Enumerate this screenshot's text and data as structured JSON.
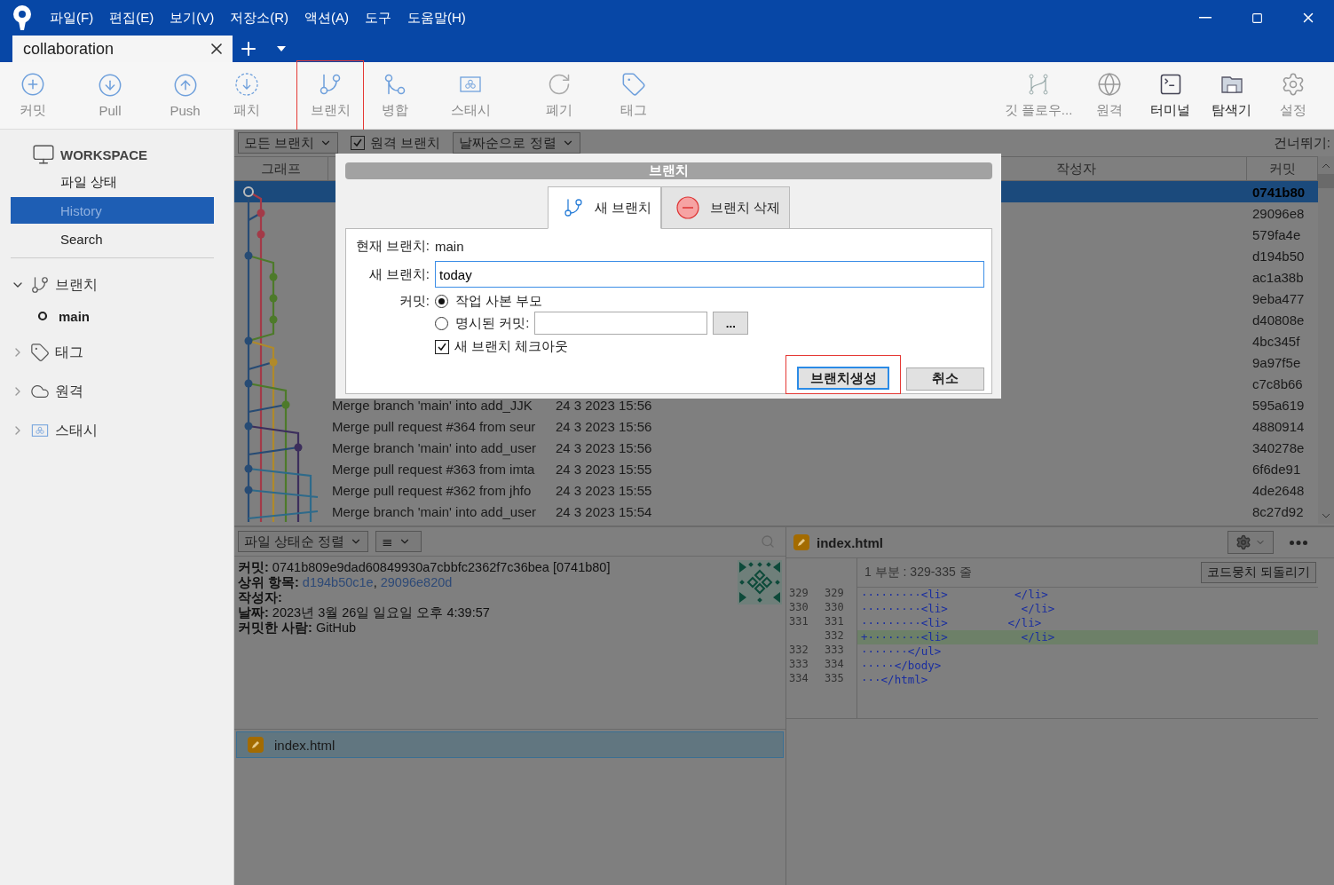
{
  "window": {
    "menu": [
      "파일(F)",
      "편집(E)",
      "보기(V)",
      "저장소(R)",
      "액션(A)",
      "도구",
      "도움말(H)"
    ]
  },
  "tabs": [
    {
      "label": "collaboration",
      "selected": true
    }
  ],
  "toolbar": {
    "left": [
      {
        "label": "커밋",
        "disabled": true,
        "highlighted": false
      },
      {
        "label": "Pull",
        "disabled": true,
        "highlighted": false
      },
      {
        "label": "Push",
        "disabled": true,
        "highlighted": false
      },
      {
        "label": "패치",
        "disabled": true,
        "highlighted": false
      },
      {
        "label": "브랜치",
        "disabled": true,
        "highlighted": true
      },
      {
        "label": "병합",
        "disabled": true,
        "highlighted": false
      },
      {
        "label": "스태시",
        "disabled": true,
        "highlighted": false
      },
      {
        "label": "폐기",
        "disabled": true,
        "highlighted": false
      },
      {
        "label": "태그",
        "disabled": true,
        "highlighted": false
      }
    ],
    "right": [
      {
        "label": "깃 플로우...",
        "disabled": true,
        "highlighted": false
      },
      {
        "label": "원격",
        "disabled": true,
        "highlighted": false
      },
      {
        "label": "터미널",
        "disabled": false,
        "highlighted": false
      },
      {
        "label": "탐색기",
        "disabled": false,
        "highlighted": false
      },
      {
        "label": "설정",
        "disabled": true,
        "highlighted": false
      }
    ]
  },
  "sidebar": {
    "workspace": {
      "title": "WORKSPACE",
      "items": [
        {
          "label": "파일 상태",
          "selected": false
        },
        {
          "label": "History",
          "selected": true
        },
        {
          "label": "Search",
          "selected": false
        }
      ]
    },
    "sections": [
      {
        "label": "브랜치",
        "expanded": true,
        "children": [
          {
            "label": "main",
            "current": true
          }
        ]
      },
      {
        "label": "태그",
        "expanded": false
      },
      {
        "label": "원격",
        "expanded": false
      },
      {
        "label": "스태시",
        "expanded": false
      }
    ]
  },
  "filters": {
    "branch_filter": "모든 브랜치",
    "remote_branches": {
      "label": "원격 브랜치",
      "checked": true
    },
    "sort": "날짜순으로 정렬",
    "jump_label": "건너뛰기:"
  },
  "table": {
    "columns": [
      "그래프",
      "작성자",
      "커밋"
    ],
    "rows": [
      {
        "hash": "0741b80",
        "selected": true
      },
      {
        "hash": "29096e8",
        "selected": false
      },
      {
        "hash": "579fa4e",
        "selected": false
      },
      {
        "hash": "d194b50",
        "selected": false
      },
      {
        "hash": "ac1a38b",
        "selected": false
      },
      {
        "hash": "9eba477",
        "selected": false
      },
      {
        "hash": "d40808e",
        "selected": false
      },
      {
        "hash": "4bc345f",
        "selected": false
      },
      {
        "hash": "9a97f5e",
        "selected": false
      },
      {
        "hash": "c7c8b66",
        "selected": false
      },
      {
        "message": "Merge branch 'main' into add_JJK",
        "date": "24 3 2023 15:56",
        "hash": "595a619",
        "selected": false
      },
      {
        "message": "Merge pull request #364 from seur",
        "date": "24 3 2023 15:56",
        "hash": "4880914",
        "selected": false
      },
      {
        "message": "Merge branch 'main' into add_user",
        "date": "24 3 2023 15:56",
        "hash": "340278e",
        "selected": false
      },
      {
        "message": "Merge pull request #363 from imta",
        "date": "24 3 2023 15:55",
        "hash": "6f6de91",
        "selected": false
      },
      {
        "message": "Merge pull request #362 from jhfo",
        "date": "24 3 2023 15:55",
        "hash": "4de2648",
        "selected": false
      },
      {
        "message": "Merge branch 'main' into add_user",
        "date": "24 3 2023 15:54",
        "hash": "8c27d92",
        "selected": false
      }
    ]
  },
  "files_pane": {
    "sort": "파일 상태순 정렬",
    "view_icon": "≣",
    "details": [
      {
        "label": "커밋:",
        "value": "0741b809e9dad60849930a7cbbfc2362f7c36bea [0741b80]"
      },
      {
        "label": "상위 항목:",
        "links": [
          "d194b50c1e",
          "29096e820d"
        ],
        "separator": ","
      },
      {
        "label": "작성자:"
      },
      {
        "label": "날짜:",
        "value": "2023년 3월 26일 일요일 오후 4:39:57"
      },
      {
        "label": "커밋한 사람:",
        "value": "GitHub"
      }
    ],
    "files": [
      {
        "name": "index.html",
        "selected": true
      }
    ]
  },
  "diff": {
    "file": "index.html",
    "hunk": "1 부분 : 329-335 줄",
    "revert": "코드뭉치 되돌리기",
    "lines": [
      {
        "old": "329",
        "new": "329",
        "kind": "context",
        "code": "·········<li>          </li>"
      },
      {
        "old": "330",
        "new": "330",
        "kind": "context",
        "code": "·········<li>           </li>"
      },
      {
        "old": "331",
        "new": "331",
        "kind": "context",
        "code": "·········<li>         </li>"
      },
      {
        "new": "332",
        "kind": "added",
        "code": "+········<li>           </li>"
      },
      {
        "old": "332",
        "new": "333",
        "kind": "context",
        "code": "·······</ul>"
      },
      {
        "old": "333",
        "new": "334",
        "kind": "context",
        "code": "·····</body>"
      },
      {
        "old": "334",
        "new": "335",
        "kind": "context",
        "code": "···</html>"
      }
    ]
  },
  "dialog": {
    "title": "브랜치",
    "tabs": [
      {
        "label": "새 브랜치",
        "selected": true
      },
      {
        "label": "브랜치 삭제",
        "selected": false
      }
    ],
    "current_branch": {
      "label": "현재 브랜치:",
      "value": "main"
    },
    "new_branch": {
      "label": "새 브랜치:",
      "value": "today"
    },
    "commit": {
      "label": "커밋:",
      "options": [
        {
          "label": "작업 사본 부모",
          "selected": true
        },
        {
          "label": "명시된 커밋:",
          "selected": false
        }
      ],
      "browse": "..."
    },
    "checkout": {
      "label": "새 브랜치 체크아웃",
      "checked": true
    },
    "buttons": [
      {
        "label": "브랜치생성",
        "primary": true,
        "highlighted": true
      },
      {
        "label": "취소",
        "primary": false,
        "highlighted": false
      }
    ]
  }
}
